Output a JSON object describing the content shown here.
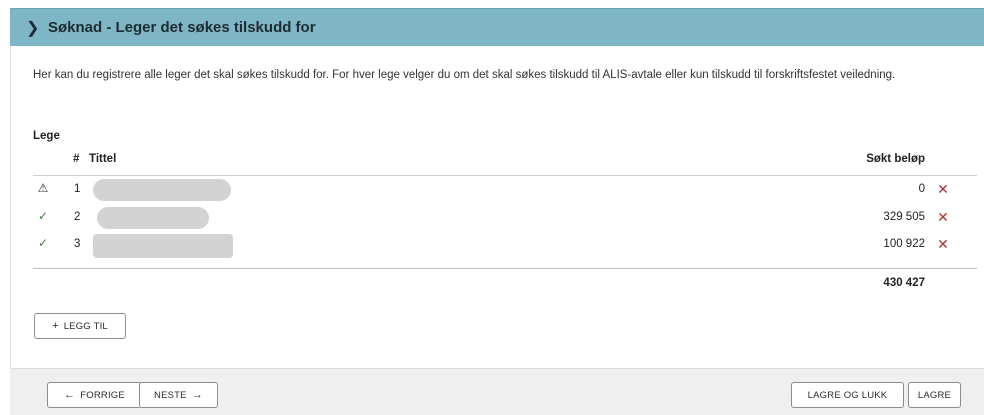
{
  "header": {
    "chevron_icon": "chevron-right-icon",
    "title": "Søknad - Leger det søkes tilskudd for"
  },
  "intro": "Her kan du registrere alle leger det skal søkes tilskudd for. For hver lege velger du om det skal søkes tilskudd til ALIS-avtale eller kun tilskudd til forskriftsfestet veiledning.",
  "section_label": "Lege",
  "table": {
    "columns": {
      "num": "#",
      "title": "Tittel",
      "amount": "Søkt beløp"
    },
    "rows": [
      {
        "status": "warning-icon",
        "status_glyph": "⚠",
        "num": "1",
        "amount": "0"
      },
      {
        "status": "check-icon",
        "status_glyph": "✓",
        "num": "2",
        "amount": "329 505"
      },
      {
        "status": "check-icon",
        "status_glyph": "✓",
        "num": "3",
        "amount": "100 922"
      }
    ],
    "delete_glyph": "✕",
    "total": "430 427"
  },
  "buttons": {
    "add": {
      "icon": "+",
      "label": "LEGG TIL"
    },
    "prev": {
      "icon": "←",
      "label": "FORRIGE"
    },
    "next": {
      "icon": "→",
      "label": "NESTE"
    },
    "save_close": "LAGRE OG LUKK",
    "save": "LAGRE"
  },
  "colors": {
    "header_bg": "#7fb6c5",
    "delete": "#b0332f",
    "check": "#3c7c3c",
    "footer_bg": "#efefef"
  }
}
